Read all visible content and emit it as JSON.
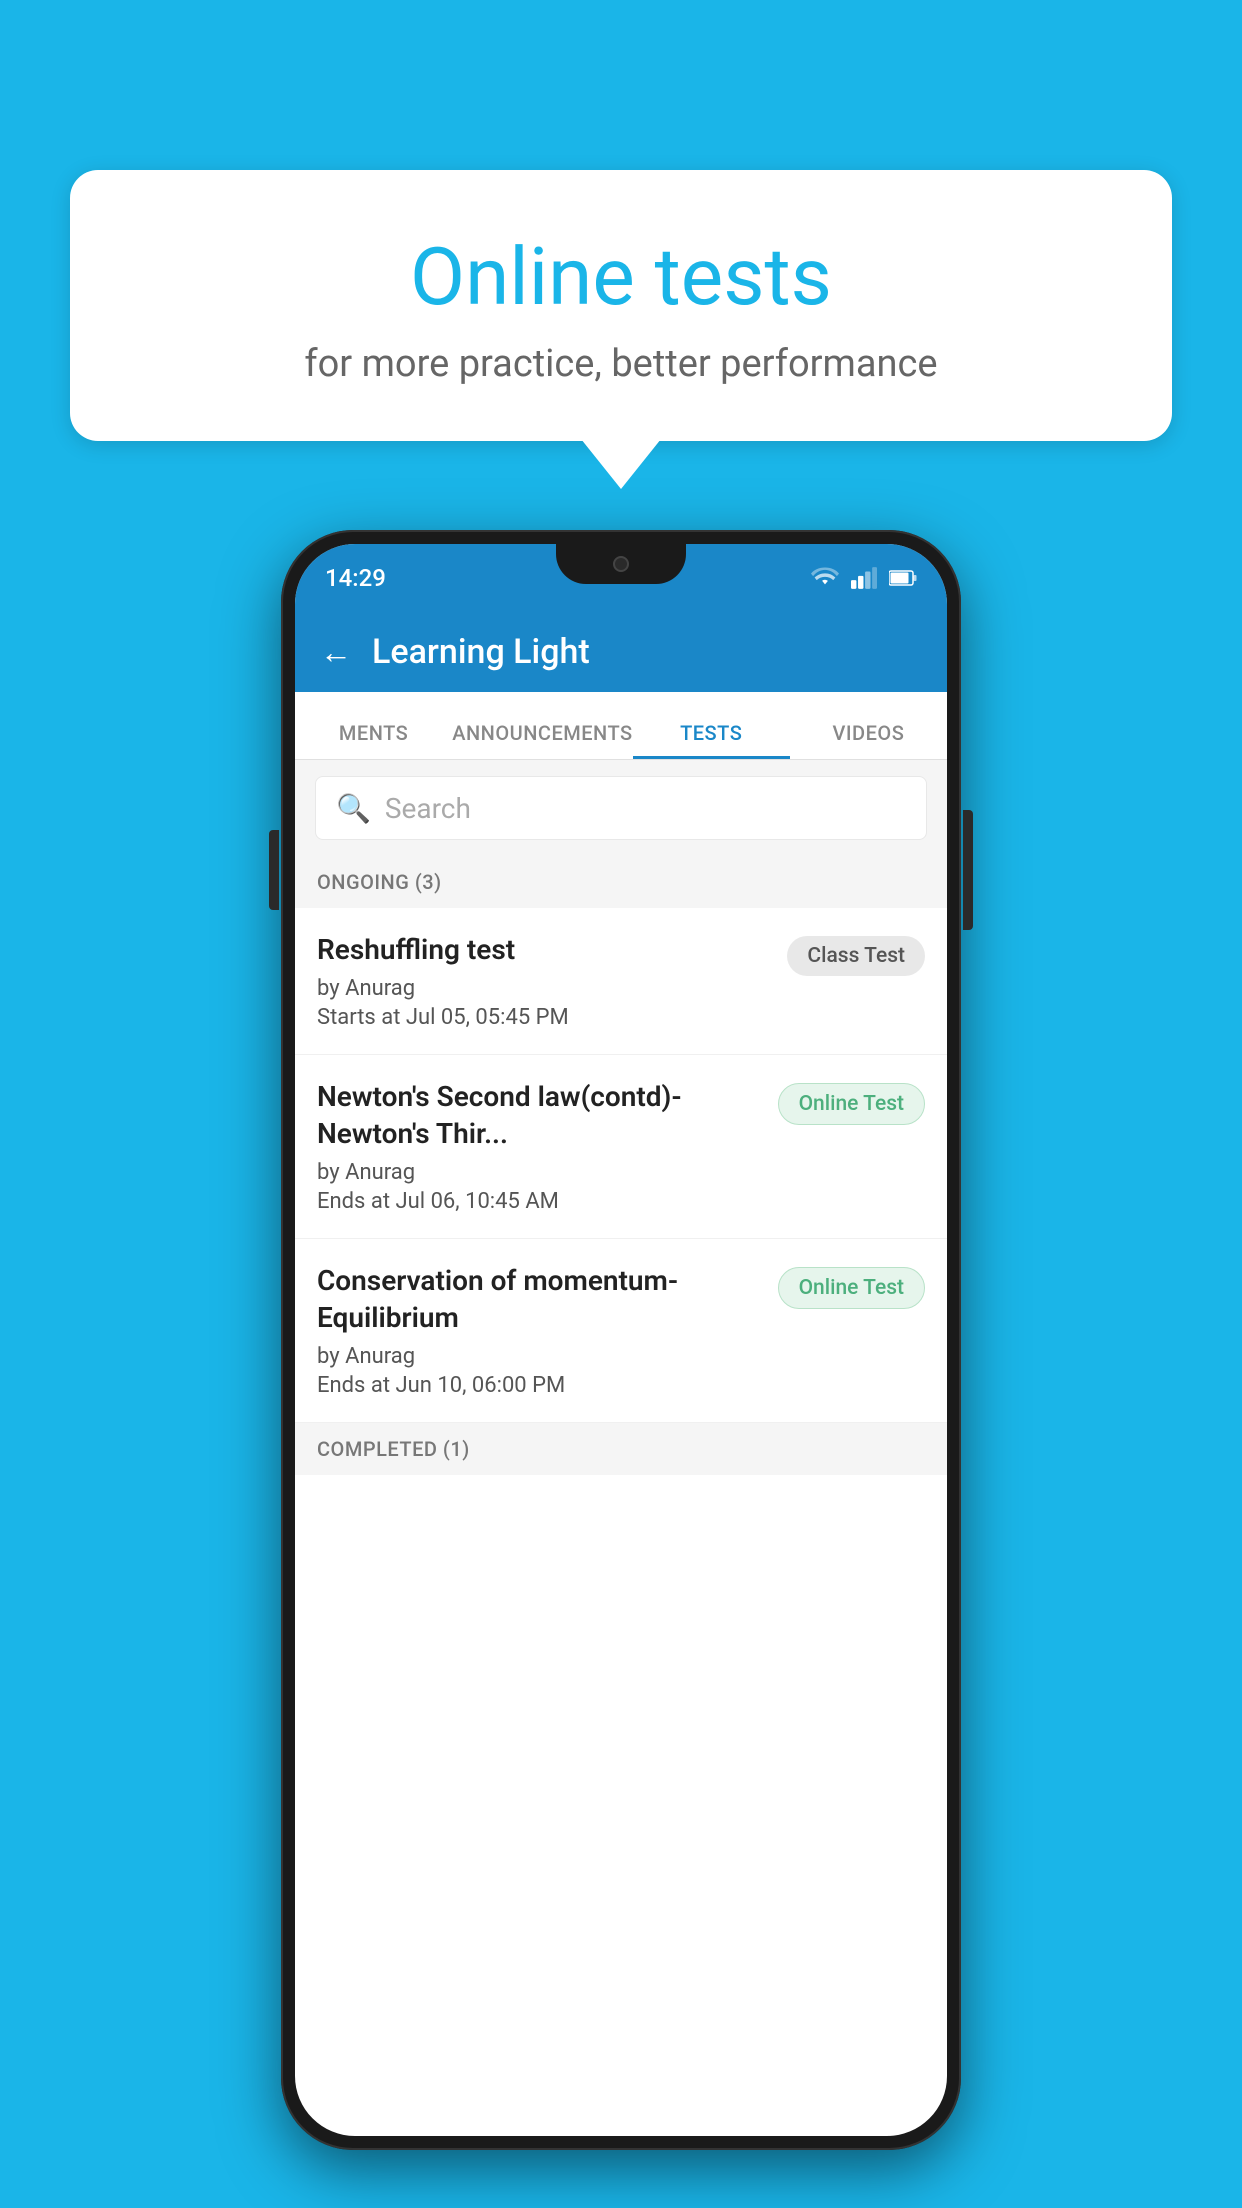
{
  "background_color": "#1ab5e8",
  "speech_bubble": {
    "title": "Online tests",
    "subtitle": "for more practice, better performance"
  },
  "phone": {
    "status_bar": {
      "time": "14:29"
    },
    "app_header": {
      "back_label": "←",
      "title": "Learning Light"
    },
    "tabs": [
      {
        "label": "MENTS",
        "active": false
      },
      {
        "label": "ANNOUNCEMENTS",
        "active": false
      },
      {
        "label": "TESTS",
        "active": true
      },
      {
        "label": "VIDEOS",
        "active": false
      }
    ],
    "search": {
      "placeholder": "Search"
    },
    "ongoing_section": {
      "label": "ONGOING (3)"
    },
    "test_items": [
      {
        "name": "Reshuffling test",
        "by": "by Anurag",
        "time": "Starts at  Jul 05, 05:45 PM",
        "badge": "Class Test",
        "badge_type": "class"
      },
      {
        "name": "Newton's Second law(contd)-Newton's Thir...",
        "by": "by Anurag",
        "time": "Ends at  Jul 06, 10:45 AM",
        "badge": "Online Test",
        "badge_type": "online"
      },
      {
        "name": "Conservation of momentum-Equilibrium",
        "by": "by Anurag",
        "time": "Ends at  Jun 10, 06:00 PM",
        "badge": "Online Test",
        "badge_type": "online"
      }
    ],
    "completed_section": {
      "label": "COMPLETED (1)"
    }
  }
}
